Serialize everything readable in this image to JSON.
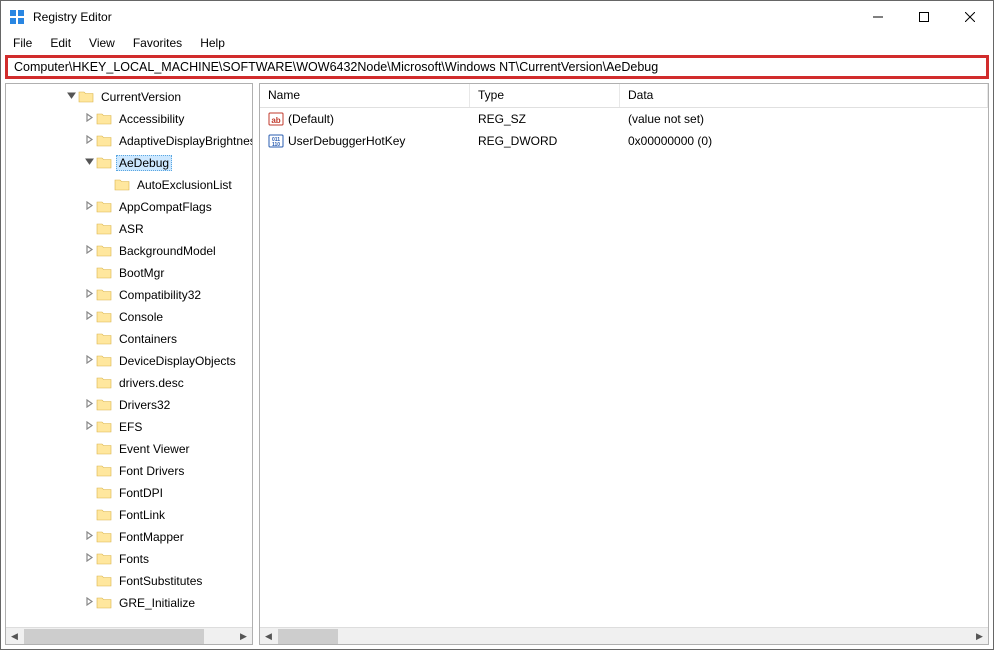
{
  "window": {
    "title": "Registry Editor"
  },
  "menu": {
    "file": "File",
    "edit": "Edit",
    "view": "View",
    "favorites": "Favorites",
    "help": "Help"
  },
  "address_bar": "Computer\\HKEY_LOCAL_MACHINE\\SOFTWARE\\WOW6432Node\\Microsoft\\Windows NT\\CurrentVersion\\AeDebug",
  "tree": [
    {
      "indent": 3,
      "exp": "v",
      "label": "CurrentVersion",
      "selected": false
    },
    {
      "indent": 4,
      "exp": ">",
      "label": "Accessibility"
    },
    {
      "indent": 4,
      "exp": ">",
      "label": "AdaptiveDisplayBrightness"
    },
    {
      "indent": 4,
      "exp": "v",
      "label": "AeDebug",
      "selected": true
    },
    {
      "indent": 5,
      "exp": "",
      "label": "AutoExclusionList"
    },
    {
      "indent": 4,
      "exp": ">",
      "label": "AppCompatFlags"
    },
    {
      "indent": 4,
      "exp": "",
      "label": "ASR"
    },
    {
      "indent": 4,
      "exp": ">",
      "label": "BackgroundModel"
    },
    {
      "indent": 4,
      "exp": "",
      "label": "BootMgr"
    },
    {
      "indent": 4,
      "exp": ">",
      "label": "Compatibility32"
    },
    {
      "indent": 4,
      "exp": ">",
      "label": "Console"
    },
    {
      "indent": 4,
      "exp": "",
      "label": "Containers"
    },
    {
      "indent": 4,
      "exp": ">",
      "label": "DeviceDisplayObjects"
    },
    {
      "indent": 4,
      "exp": "",
      "label": "drivers.desc"
    },
    {
      "indent": 4,
      "exp": ">",
      "label": "Drivers32"
    },
    {
      "indent": 4,
      "exp": ">",
      "label": "EFS"
    },
    {
      "indent": 4,
      "exp": "",
      "label": "Event Viewer"
    },
    {
      "indent": 4,
      "exp": "",
      "label": "Font Drivers"
    },
    {
      "indent": 4,
      "exp": "",
      "label": "FontDPI"
    },
    {
      "indent": 4,
      "exp": "",
      "label": "FontLink"
    },
    {
      "indent": 4,
      "exp": ">",
      "label": "FontMapper"
    },
    {
      "indent": 4,
      "exp": ">",
      "label": "Fonts"
    },
    {
      "indent": 4,
      "exp": "",
      "label": "FontSubstitutes"
    },
    {
      "indent": 4,
      "exp": ">",
      "label": "GRE_Initialize"
    }
  ],
  "list": {
    "headers": {
      "name": "Name",
      "type": "Type",
      "data": "Data"
    },
    "rows": [
      {
        "icon": "string",
        "name": "(Default)",
        "type": "REG_SZ",
        "data": "(value not set)"
      },
      {
        "icon": "binary",
        "name": "UserDebuggerHotKey",
        "type": "REG_DWORD",
        "data": "0x00000000 (0)"
      }
    ]
  }
}
